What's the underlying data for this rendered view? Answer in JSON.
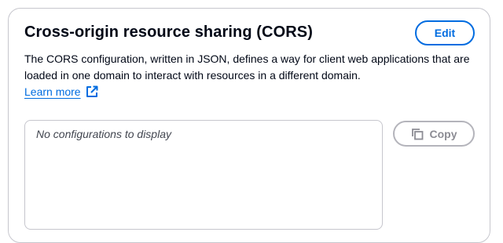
{
  "panel": {
    "title": "Cross-origin resource sharing (CORS)",
    "edit_label": "Edit",
    "description": "The CORS configuration, written in JSON, defines a way for client web applications that are loaded in one domain to interact with resources in a different domain.",
    "learn_more_label": "Learn more",
    "learn_more_icon": "external-link-icon",
    "code_empty_text": "No configurations to display",
    "copy_label": "Copy",
    "copy_icon": "copy-icon",
    "copy_disabled": true
  },
  "colors": {
    "link": "#006ce0",
    "text": "#000716",
    "border": "#c6c6cd",
    "disabled": "#8c8c94"
  }
}
